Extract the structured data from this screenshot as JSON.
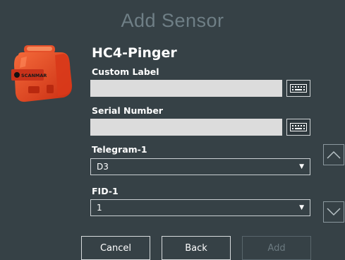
{
  "dialog": {
    "title": "Add Sensor",
    "sensor_name": "HC4-Pinger",
    "device_image": "orange-sensor-device-image"
  },
  "form": {
    "custom_label": {
      "label": "Custom Label",
      "value": ""
    },
    "serial_number": {
      "label": "Serial Number",
      "value": ""
    },
    "telegram": {
      "label": "Telegram-1",
      "selected": "D3"
    },
    "fid": {
      "label": "FID-1",
      "selected": "1"
    }
  },
  "buttons": {
    "cancel": "Cancel",
    "back": "Back",
    "add": "Add"
  },
  "icons": {
    "keyboard": "keyboard-icon",
    "scroll_up": "chevron-up-icon",
    "scroll_down": "chevron-down-icon"
  },
  "colors": {
    "background": "#364146",
    "title": "#6f7f86",
    "input_fill": "#dcdcdc",
    "device_orange": "#e8431f"
  }
}
